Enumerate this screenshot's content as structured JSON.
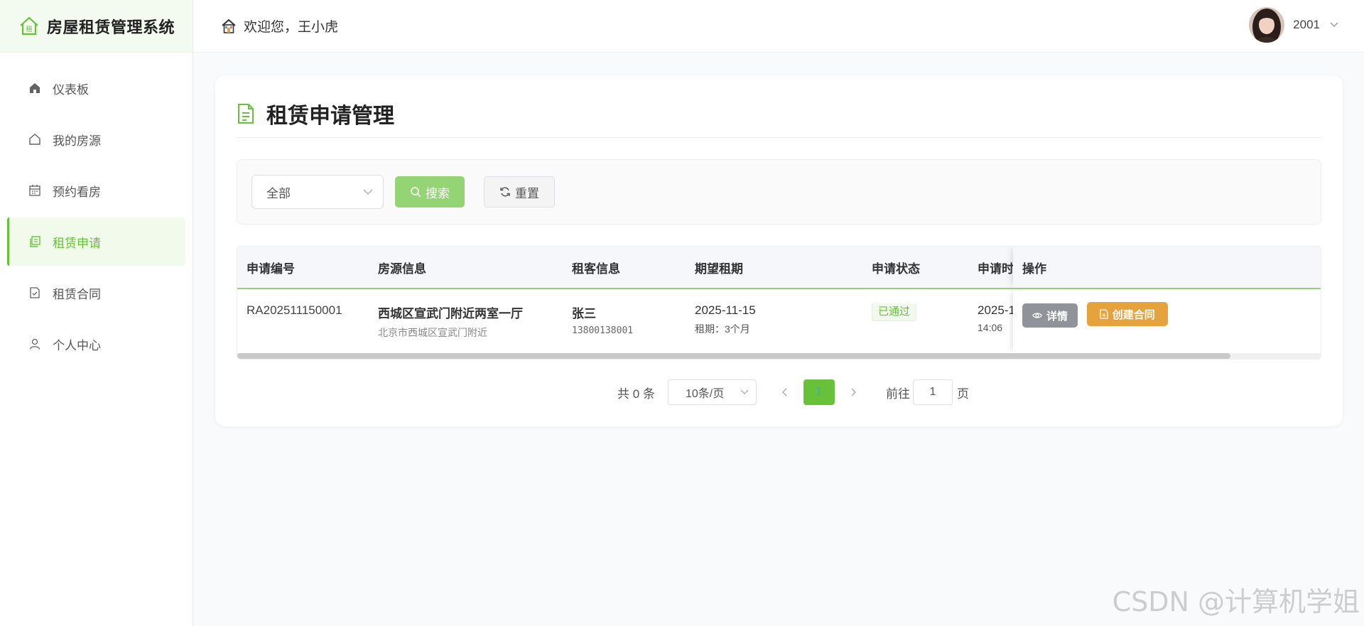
{
  "app": {
    "title": "房屋租赁管理系统"
  },
  "sidebar": {
    "items": [
      {
        "label": "仪表板",
        "icon": "home-filled-icon"
      },
      {
        "label": "我的房源",
        "icon": "house-icon"
      },
      {
        "label": "预约看房",
        "icon": "calendar-icon"
      },
      {
        "label": "租赁申请",
        "icon": "copy-document-icon",
        "active": true
      },
      {
        "label": "租赁合同",
        "icon": "document-checked-icon"
      },
      {
        "label": "个人中心",
        "icon": "user-icon"
      }
    ]
  },
  "header": {
    "welcome": "欢迎您，王小虎",
    "username": "2001"
  },
  "page": {
    "title": "租赁申请管理"
  },
  "filter": {
    "status_value": "全部",
    "search_label": "搜索",
    "reset_label": "重置"
  },
  "table": {
    "headers": [
      "申请编号",
      "房源信息",
      "租客信息",
      "期望租期",
      "申请状态",
      "申请时",
      "操作"
    ],
    "rows": [
      {
        "id": "RA202511150001",
        "house_title": "西城区宣武门附近两室一厅",
        "house_address": "北京市西城区宣武门附近",
        "tenant_name": "张三",
        "tenant_phone": "13800138001",
        "start_date": "2025-11-15",
        "duration": "租期：3个月",
        "status": "已通过",
        "apply_date": "2025-1",
        "apply_time": "14:06",
        "detail_label": "详情",
        "contract_label": "创建合同"
      }
    ]
  },
  "pagination": {
    "total": "共 0 条",
    "page_size": "10条/页",
    "current_page": "1",
    "goto_label": "前往",
    "goto_value": "1",
    "page_unit": "页"
  },
  "watermark": "CSDN @计算机学姐",
  "colors": {
    "primary": "#67c23a",
    "primary_light": "#95d475",
    "warning": "#e6a23c",
    "info": "#909399"
  }
}
